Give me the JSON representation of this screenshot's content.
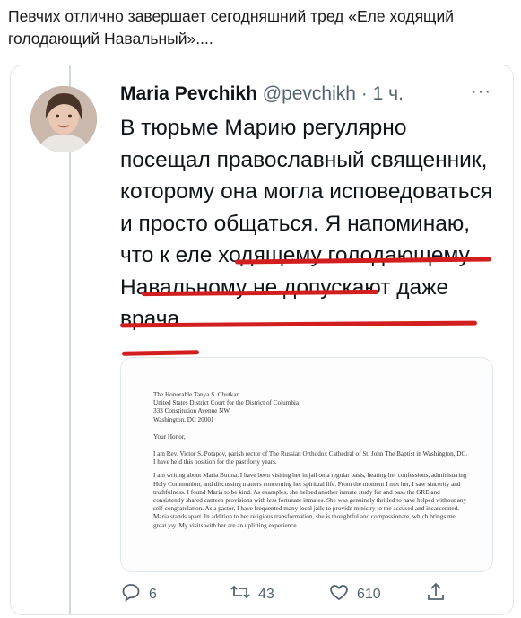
{
  "caption": "Певчих отлично завершает сегодняшний тред «Еле ходящий голодающий Навальный»....",
  "tweet": {
    "author_name": "Maria Pevchikh",
    "handle": "@pevchikh",
    "separator": "·",
    "time": "1 ч.",
    "more": "···",
    "text": "В тюрьме Марию регулярно посещал православный священник, которому она могла исповедоваться и просто общаться. Я напоминаю, что к еле ходящему голодающему Навальному не допускают даже врача.",
    "underline_color": "#d21e1e"
  },
  "document": {
    "address_1": "The Honorable Tanya S. Chutkan",
    "address_2": "United States District Court for the District of Columbia",
    "address_3": "333 Constitution Avenue NW",
    "address_4": "Washington, DC 20001",
    "salutation": "Your Honor,",
    "para_1": "I am Rev. Victor S. Potapov, parish rector of The Russian Orthodox Cathedral of St. John The Baptist in Washington, DC. I have held this position for the past forty years.",
    "para_2": "I am writing about Maria Butina. I have been visiting her in jail on a regular basis, hearing her confessions, administering Holy Communion, and discussing matters concerning her spiritual life. From the moment I met her, I saw sincerity and truthfulness. I found Maria to be kind. As examples, she helped another inmate study for and pass the GRE and consistently shared canteen provisions with less fortunate inmates. She was genuinely thrilled to have helped without any self-congratulation. As a pastor, I have frequented many local jails to provide ministry to the accused and incarcerated. Maria stands apart. In addition to her religious transformation, she is thoughtful and compassionate, which brings me great joy. My visits with her are an uplifting experience."
  },
  "actions": {
    "replies": "6",
    "retweets": "43",
    "likes": "610"
  },
  "icons": {
    "reply": "reply-icon",
    "retweet": "retweet-icon",
    "like": "heart-icon",
    "share": "share-icon"
  }
}
